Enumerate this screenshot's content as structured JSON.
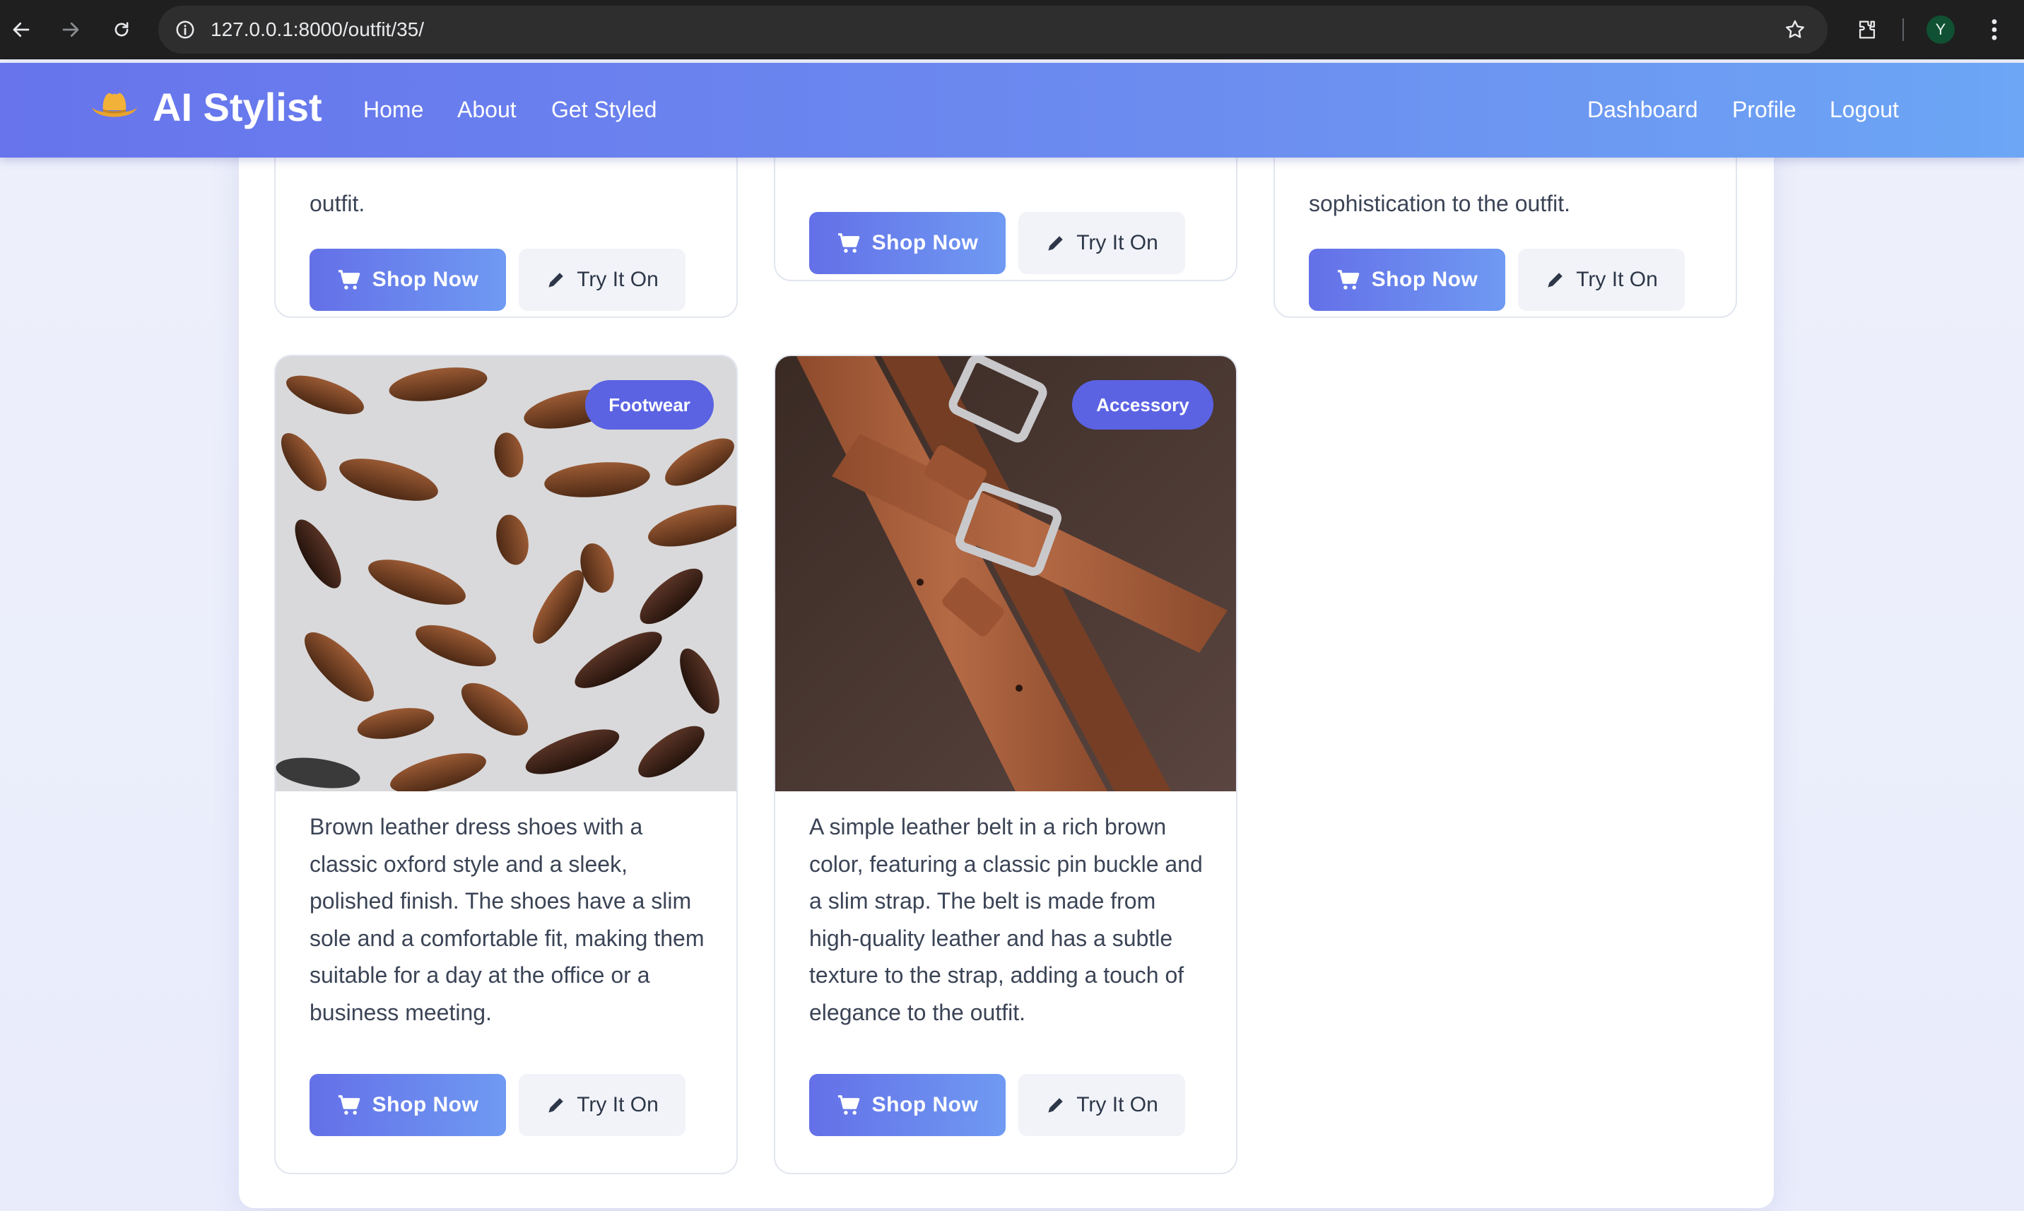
{
  "browser": {
    "url": "127.0.0.1:8000/outfit/35/",
    "profile_initial": "Y"
  },
  "navbar": {
    "brand": "AI Stylist",
    "links_left": [
      "Home",
      "About",
      "Get Styled"
    ],
    "links_right": [
      "Dashboard",
      "Profile",
      "Logout"
    ]
  },
  "cards_top": [
    {
      "desc_tail": "outfit.",
      "shop_label": "Shop Now",
      "try_label": "Try It On"
    },
    {
      "desc_tail": "",
      "shop_label": "Shop Now",
      "try_label": "Try It On"
    },
    {
      "desc_tail": "sophistication to the outfit.",
      "shop_label": "Shop Now",
      "try_label": "Try It On"
    }
  ],
  "cards": [
    {
      "badge": "Footwear",
      "description": "Brown leather dress shoes with a classic oxford style and a sleek, polished finish. The shoes have a slim sole and a comfortable fit, making them suitable for a day at the office or a business meeting.",
      "shop_label": "Shop Now",
      "try_label": "Try It On"
    },
    {
      "badge": "Accessory",
      "description": "A simple leather belt in a rich brown color, featuring a classic pin buckle and a slim strap. The belt is made from high-quality leather and has a subtle texture to the strap, adding a touch of elegance to the outfit.",
      "shop_label": "Shop Now",
      "try_label": "Try It On"
    }
  ],
  "colors": {
    "accent": "#6470e8",
    "badge": "#5b63e3"
  }
}
